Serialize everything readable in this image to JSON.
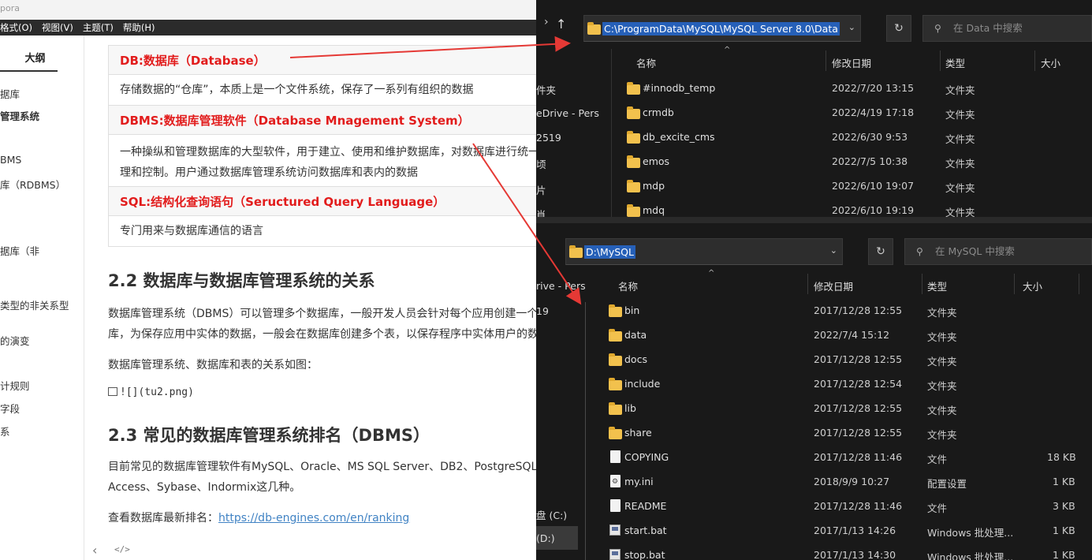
{
  "typora": {
    "title": "pora",
    "menu": [
      "格式(O)",
      "视图(V)",
      "主题(T)",
      "帮助(H)"
    ],
    "outline_tab": "大纲",
    "outline_items": [
      "据库",
      "管理系统",
      "BMS",
      "库（RDBMS）",
      "据库（非",
      "类型的非关系型",
      "的演变",
      "计规则",
      "字段",
      "系"
    ],
    "table": [
      {
        "term": "DB:数据库（Database）",
        "desc": [
          "存储数据的“仓库”，本质上是一个文件系统，保存了一系列有组织的数据"
        ]
      },
      {
        "term": "DBMS:数据库管理软件（Database Mnagement System）",
        "desc": [
          "一种操纵和管理数据库的大型软件，用于建立、使用和维护数据库，对数据库进行统一管",
          "理和控制。用户通过数据库管理系统访问数据库和表内的数据"
        ]
      },
      {
        "term": "SQL:结构化查询语句（Seructured Query Language）",
        "desc": [
          "专门用来与数据库通信的语言"
        ]
      }
    ],
    "h2_1": "2.2 数据库与数据库管理系统的关系",
    "p1_line1": "数据库管理系统（DBMS）可以管理多个数据库，一般开发人员会针对每个应用创建一个数据",
    "p1_line2": "库，为保存应用中实体的数据，一般会在数据库创建多个表，以保存程序中实体用户的数据。",
    "p2": "数据库管理系统、数据库和表的关系如图：",
    "img_md": "![](tu2.png)",
    "h2_2": "2.3 常见的数据库管理系统排名（DBMS）",
    "p3_line1": "目前常见的数据库管理软件有MySQL、Oracle、MS SQL Server、DB2、PostgreSQL、",
    "p3_line2": "Access、Sybase、Indormix这几种。",
    "p4_prefix": "查看数据库最新排名：",
    "p4_link": "https://db-engines.com/en/ranking",
    "bottom_left": "‹",
    "bottom_code": "</>"
  },
  "explorer1": {
    "up_arrow": "↑",
    "path": "C:\\ProgramData\\MySQL\\MySQL Server 8.0\\Data",
    "search_placeholder": "在 Data 中搜索",
    "headers": {
      "name": "名称",
      "date": "修改日期",
      "type": "类型",
      "size": "大小"
    },
    "nav": [
      "件夹",
      "eDrive - Pers",
      "2519",
      "顷",
      "片",
      "肖"
    ],
    "rows": [
      {
        "name": "#innodb_temp",
        "date": "2022/7/20 13:15",
        "type": "文件夹",
        "size": ""
      },
      {
        "name": "crmdb",
        "date": "2022/4/19 17:18",
        "type": "文件夹",
        "size": ""
      },
      {
        "name": "db_excite_cms",
        "date": "2022/6/30 9:53",
        "type": "文件夹",
        "size": ""
      },
      {
        "name": "emos",
        "date": "2022/7/5 10:38",
        "type": "文件夹",
        "size": ""
      },
      {
        "name": "mdp",
        "date": "2022/6/10 19:07",
        "type": "文件夹",
        "size": ""
      },
      {
        "name": "mdq",
        "date": "2022/6/10 19:19",
        "type": "文件夹",
        "size": ""
      }
    ]
  },
  "explorer2": {
    "path": "D:\\MySQL",
    "search_placeholder": "在 MySQL 中搜索",
    "headers": {
      "name": "名称",
      "date": "修改日期",
      "type": "类型",
      "size": "大小"
    },
    "nav": [
      "rive - Pers",
      "19",
      "盘 (C:)",
      "(D:)"
    ],
    "rows": [
      {
        "name": "bin",
        "date": "2017/12/28 12:55",
        "type": "文件夹",
        "size": "",
        "icon": "folder"
      },
      {
        "name": "data",
        "date": "2022/7/4 15:12",
        "type": "文件夹",
        "size": "",
        "icon": "folder"
      },
      {
        "name": "docs",
        "date": "2017/12/28 12:55",
        "type": "文件夹",
        "size": "",
        "icon": "folder"
      },
      {
        "name": "include",
        "date": "2017/12/28 12:54",
        "type": "文件夹",
        "size": "",
        "icon": "folder"
      },
      {
        "name": "lib",
        "date": "2017/12/28 12:55",
        "type": "文件夹",
        "size": "",
        "icon": "folder"
      },
      {
        "name": "share",
        "date": "2017/12/28 12:55",
        "type": "文件夹",
        "size": "",
        "icon": "folder"
      },
      {
        "name": "COPYING",
        "date": "2017/12/28 11:46",
        "type": "文件",
        "size": "18 KB",
        "icon": "file"
      },
      {
        "name": "my.ini",
        "date": "2018/9/9 10:27",
        "type": "配置设置",
        "size": "1 KB",
        "icon": "ini"
      },
      {
        "name": "README",
        "date": "2017/12/28 11:46",
        "type": "文件",
        "size": "3 KB",
        "icon": "file"
      },
      {
        "name": "start.bat",
        "date": "2017/1/13 14:26",
        "type": "Windows 批处理...",
        "size": "1 KB",
        "icon": "bat"
      },
      {
        "name": "stop.bat",
        "date": "2017/1/13 14:30",
        "type": "Windows 批处理...",
        "size": "1 KB",
        "icon": "bat"
      }
    ]
  },
  "colors": {
    "accent_red": "#e21c1c",
    "selection_blue": "#2660b8",
    "folder_yellow": "#f2c14d",
    "link_blue": "#4183c4"
  }
}
